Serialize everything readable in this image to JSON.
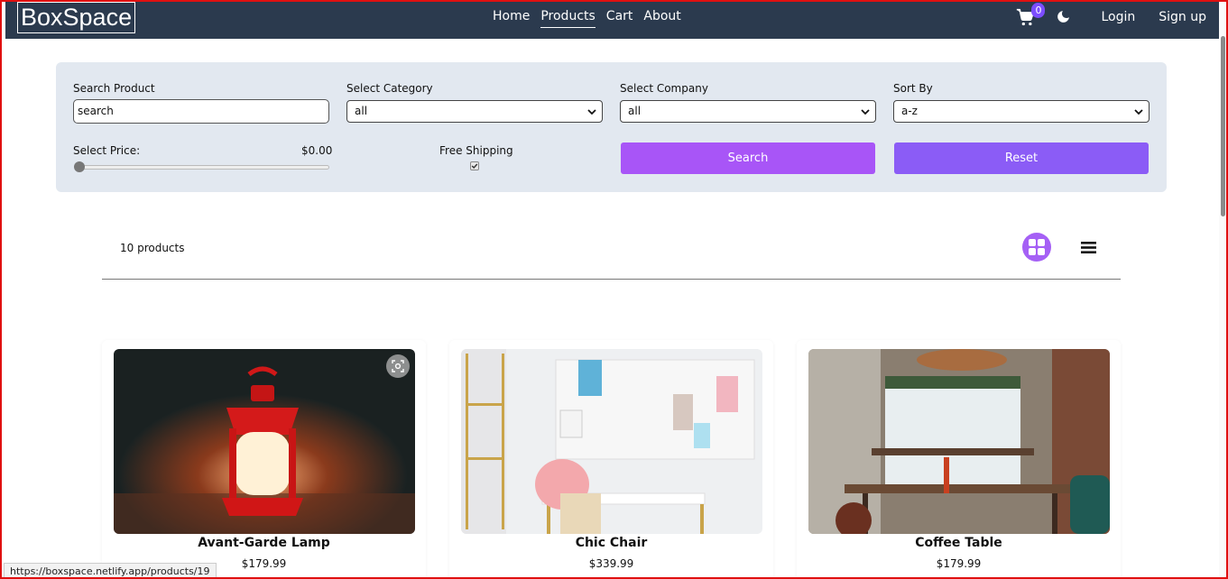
{
  "navbar": {
    "logo": "BoxSpace",
    "links": [
      "Home",
      "Products",
      "Cart",
      "About"
    ],
    "active_link": "Products",
    "cart_count": "0",
    "login": "Login",
    "signup": "Sign up",
    "icons": [
      "cart-icon",
      "moon-icon"
    ],
    "background": "#2b3a4e"
  },
  "filters": {
    "search": {
      "label": "Search Product",
      "value": "search"
    },
    "category": {
      "label": "Select Category",
      "value": "all"
    },
    "company": {
      "label": "Select Company",
      "value": "all"
    },
    "sort": {
      "label": "Sort By",
      "value": "a-z"
    },
    "price": {
      "label": "Select Price:",
      "value": "$0.00",
      "level": 0
    },
    "shipping": {
      "label": "Free Shipping",
      "checked": true
    },
    "search_button": "Search",
    "reset_button": "Reset",
    "panel_color": "#e2e8f0",
    "search_button_color": "#a855f7",
    "reset_button_color": "#8b5cf6"
  },
  "products_header": {
    "count": "10 products",
    "layout_icons": [
      "grid-icon",
      "list-icon"
    ],
    "active_layout": "grid"
  },
  "products": [
    {
      "title": "Avant-Garde Lamp",
      "price": "$179.99"
    },
    {
      "title": "Chic Chair",
      "price": "$339.99"
    },
    {
      "title": "Coffee Table",
      "price": "$179.99"
    }
  ],
  "status_bar": {
    "url": "https://boxspace.netlify.app/products/19"
  }
}
